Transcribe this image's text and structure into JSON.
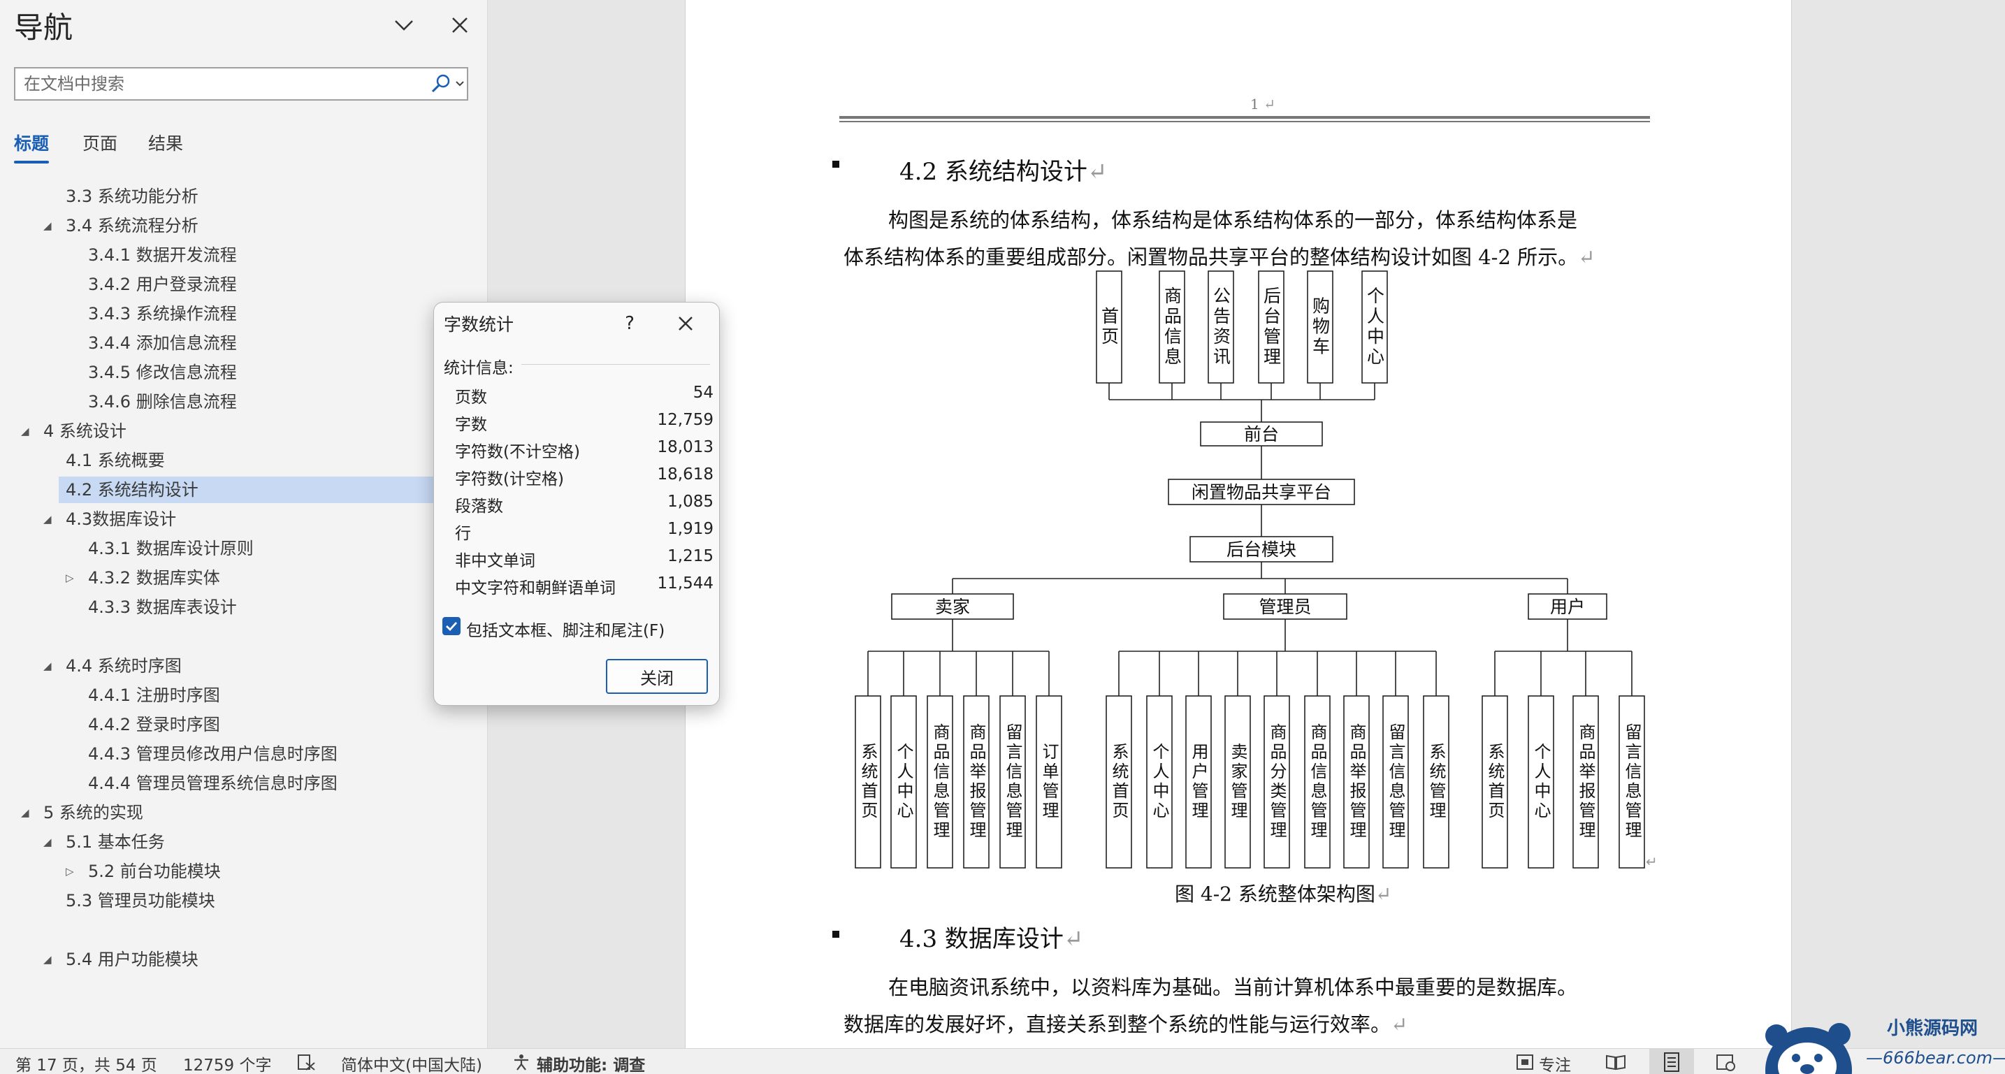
{
  "nav": {
    "title": "导航",
    "search_placeholder": "在文档中搜索",
    "tabs": [
      "标题",
      "页面",
      "结果"
    ],
    "headings": [
      {
        "text": "3.3 系统功能分析",
        "level": 2,
        "toggle": "none"
      },
      {
        "text": "3.4 系统流程分析",
        "level": 2,
        "toggle": "expanded"
      },
      {
        "text": "3.4.1 数据开发流程",
        "level": 3,
        "toggle": "none"
      },
      {
        "text": "3.4.2 用户登录流程",
        "level": 3,
        "toggle": "none"
      },
      {
        "text": "3.4.3 系统操作流程",
        "level": 3,
        "toggle": "none"
      },
      {
        "text": "3.4.4 添加信息流程",
        "level": 3,
        "toggle": "none"
      },
      {
        "text": "3.4.5 修改信息流程",
        "level": 3,
        "toggle": "none"
      },
      {
        "text": "3.4.6 删除信息流程",
        "level": 3,
        "toggle": "none"
      },
      {
        "text": "4 系统设计",
        "level": 1,
        "toggle": "expanded"
      },
      {
        "text": "4.1 系统概要",
        "level": 2,
        "toggle": "none"
      },
      {
        "text": "4.2 系统结构设计",
        "level": 2,
        "toggle": "none",
        "selected": true
      },
      {
        "text": "4.3数据库设计",
        "level": 2,
        "toggle": "expanded"
      },
      {
        "text": "4.3.1 数据库设计原则",
        "level": 3,
        "toggle": "none"
      },
      {
        "text": "4.3.2 数据库实体",
        "level": 3,
        "toggle": "collapsed"
      },
      {
        "text": "4.3.3 数据库表设计",
        "level": 3,
        "toggle": "none"
      },
      {
        "text": "",
        "level": 3,
        "toggle": "none"
      },
      {
        "text": "4.4 系统时序图",
        "level": 2,
        "toggle": "expanded"
      },
      {
        "text": "4.4.1 注册时序图",
        "level": 3,
        "toggle": "none"
      },
      {
        "text": "4.4.2 登录时序图",
        "level": 3,
        "toggle": "none"
      },
      {
        "text": "4.4.3 管理员修改用户信息时序图",
        "level": 3,
        "toggle": "none"
      },
      {
        "text": "4.4.4 管理员管理系统信息时序图",
        "level": 3,
        "toggle": "none"
      },
      {
        "text": "5 系统的实现",
        "level": 1,
        "toggle": "expanded"
      },
      {
        "text": "5.1 基本任务",
        "level": 2,
        "toggle": "expanded"
      },
      {
        "text": "5.2 前台功能模块",
        "level": 3,
        "toggle": "collapsed"
      },
      {
        "text": "5.3 管理员功能模块",
        "level": 2,
        "toggle": "none"
      },
      {
        "text": "",
        "level": 2,
        "toggle": "none"
      },
      {
        "text": "5.4 用户功能模块",
        "level": 2,
        "toggle": "expanded"
      }
    ]
  },
  "doc": {
    "page_number": "1",
    "heading_42": "4.2  系统结构设计",
    "para_42_line1": "构图是系统的体系结构，体系结构是体系结构体系的一部分，体系结构体系是",
    "para_42_line2": "体系结构体系的重要组成部分。闲置物品共享平台的整体结构设计如图 4-2 所示。",
    "figure_caption": "图 4-2  系统整体架构图",
    "heading_43": "4.3 数据库设计",
    "para_43_line1": "在电脑资讯系统中，以资料库为基础。当前计算机体系中最重要的是数据库。",
    "para_43_line2": "数据库的发展好坏，直接关系到整个系统的性能与运行效率。"
  },
  "diagram": {
    "front_modules": [
      "首页",
      "商品信息",
      "公告资讯",
      "后台管理",
      "购物车",
      "个人中心"
    ],
    "frontend": "前台",
    "platform": "闲置物品共享平台",
    "backend": "后台模块",
    "roles": [
      {
        "name": "卖家",
        "modules": [
          "系统首页",
          "个人中心",
          "商品信息管理",
          "商品举报管理",
          "留言信息管理",
          "订单管理"
        ]
      },
      {
        "name": "管理员",
        "modules": [
          "系统首页",
          "个人中心",
          "用户管理",
          "卖家管理",
          "商品分类管理",
          "商品信息管理",
          "商品举报管理",
          "留言信息管理",
          "系统管理"
        ]
      },
      {
        "name": "用户",
        "modules": [
          "系统首页",
          "个人中心",
          "商品举报管理",
          "留言信息管理"
        ]
      }
    ]
  },
  "dialog": {
    "title": "字数统计",
    "help": "?",
    "stats_label": "统计信息:",
    "stats": [
      {
        "label": "页数",
        "value": "54"
      },
      {
        "label": "字数",
        "value": "12,759"
      },
      {
        "label": "字符数(不计空格)",
        "value": "18,013"
      },
      {
        "label": "字符数(计空格)",
        "value": "18,618"
      },
      {
        "label": "段落数",
        "value": "1,085"
      },
      {
        "label": "行",
        "value": "1,919"
      },
      {
        "label": "非中文单词",
        "value": "1,215"
      },
      {
        "label": "中文字符和朝鲜语单词",
        "value": "11,544"
      }
    ],
    "include_label": "包括文本框、脚注和尾注(F)",
    "include_checked": true,
    "close_label": "关闭"
  },
  "status": {
    "page_info": "第 17 页，共 54 页",
    "word_count": "12759 个字",
    "language": "简体中文(中国大陆)",
    "accessibility": "辅助功能: 调查",
    "focus": "专注"
  },
  "watermark": {
    "brand": "小熊源码网",
    "url": "—666bear.com—"
  },
  "colors": {
    "accent": "#1a5fb4",
    "selected_bg": "#c7d9f3",
    "nav_bg": "#f3f3f3"
  }
}
